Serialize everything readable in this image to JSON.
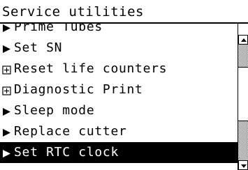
{
  "title": "Service utilities",
  "menu": {
    "items": [
      {
        "label": "Prime Tubes",
        "marker": "arrow-right-icon",
        "selected": false
      },
      {
        "label": "Set SN",
        "marker": "arrow-right-icon",
        "selected": false
      },
      {
        "label": "Reset life counters",
        "marker": "boxed-plus-icon",
        "selected": false
      },
      {
        "label": "Diagnostic Print",
        "marker": "boxed-plus-icon",
        "selected": false
      },
      {
        "label": "Sleep mode",
        "marker": "arrow-right-icon",
        "selected": false
      },
      {
        "label": "Replace cutter",
        "marker": "arrow-right-icon",
        "selected": false
      },
      {
        "label": "Set RTC clock",
        "marker": "arrow-right-icon",
        "selected": true
      }
    ]
  },
  "scrollbar": {
    "up_icon": "scroll-up-arrow-icon",
    "down_icon": "scroll-down-arrow-icon"
  }
}
